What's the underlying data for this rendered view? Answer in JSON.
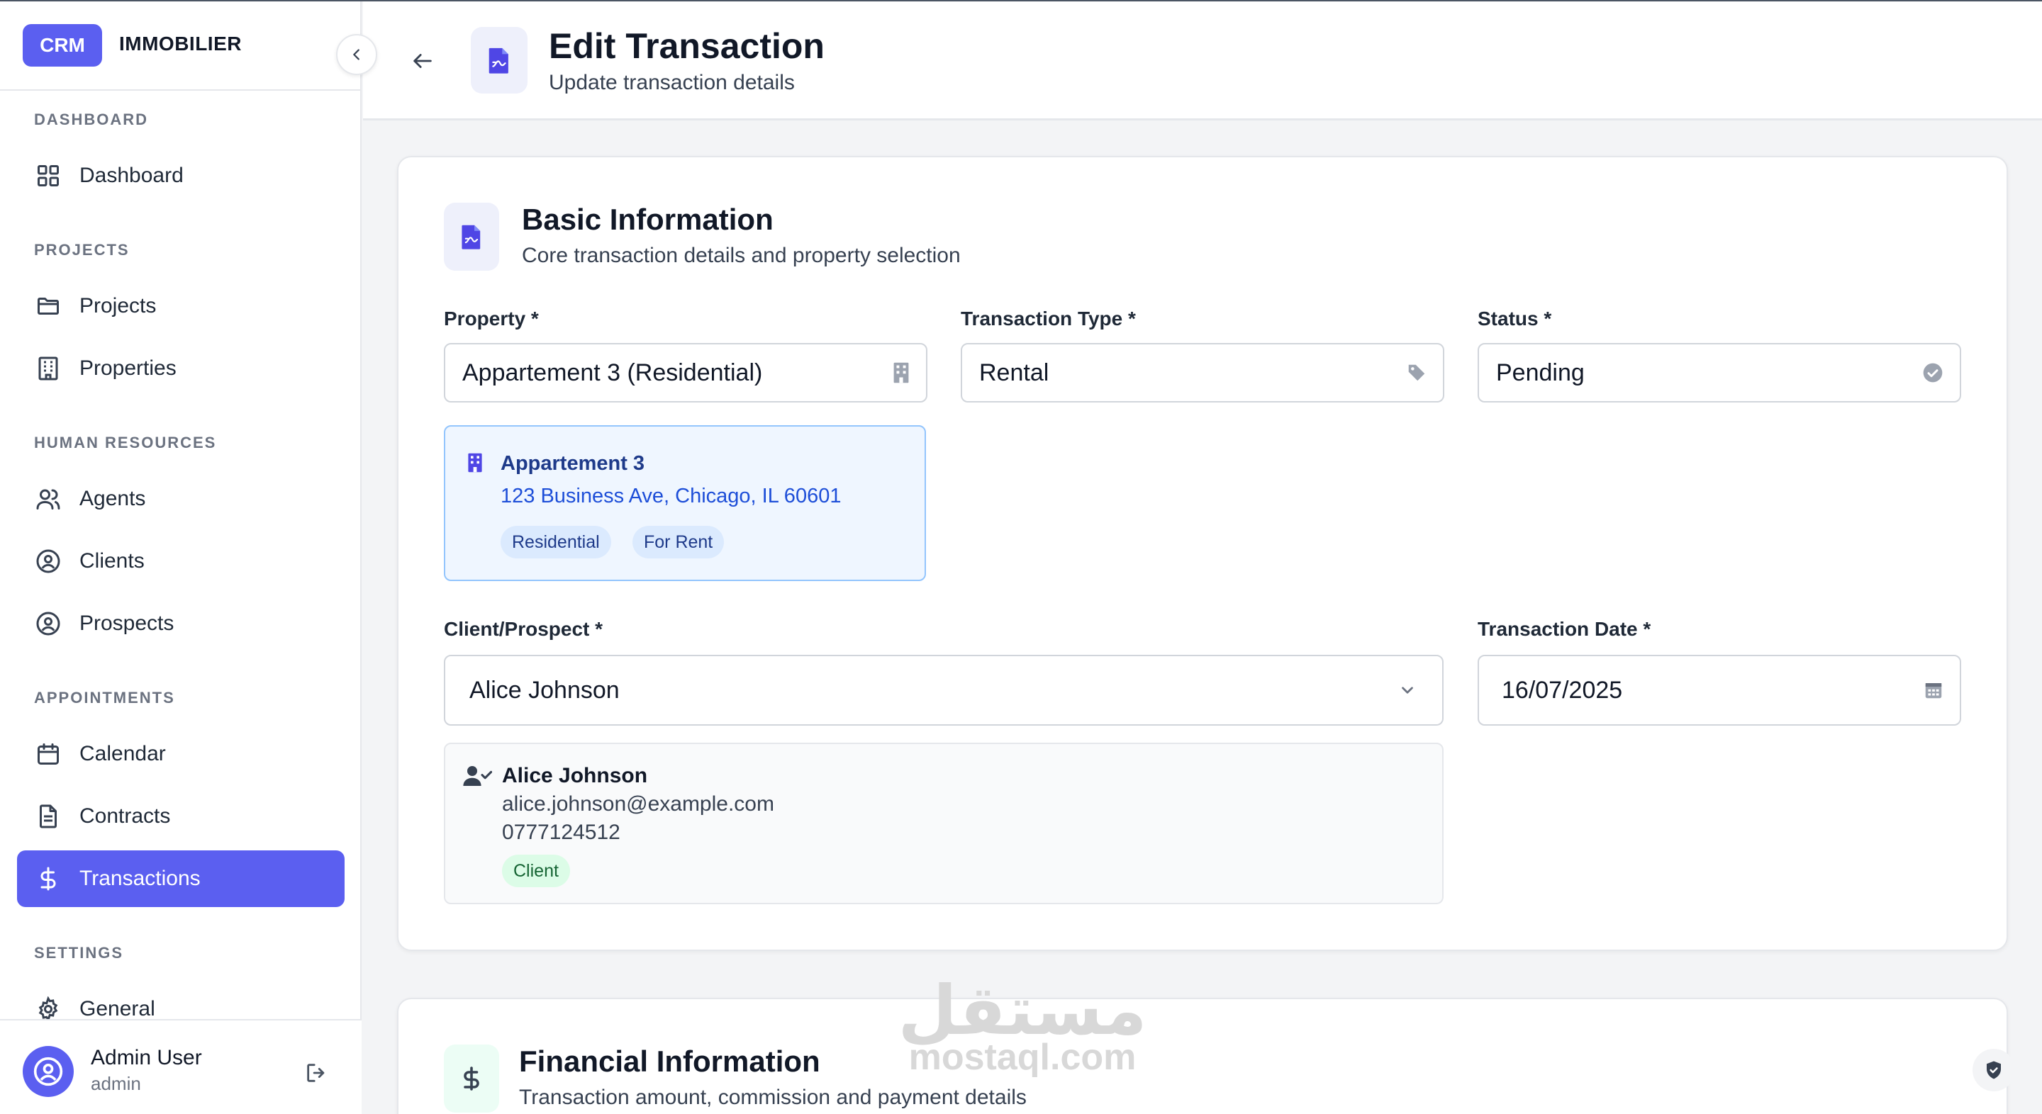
{
  "brand": {
    "badge": "CRM",
    "name": "IMMOBILIER"
  },
  "sidebar": {
    "sections": [
      {
        "title": "DASHBOARD",
        "items": [
          {
            "label": "Dashboard",
            "icon": "grid-icon"
          }
        ]
      },
      {
        "title": "PROJECTS",
        "items": [
          {
            "label": "Projects",
            "icon": "folder-icon"
          },
          {
            "label": "Properties",
            "icon": "building-icon"
          }
        ]
      },
      {
        "title": "HUMAN RESOURCES",
        "items": [
          {
            "label": "Agents",
            "icon": "users-icon"
          },
          {
            "label": "Clients",
            "icon": "user-circle-icon"
          },
          {
            "label": "Prospects",
            "icon": "user-circle-icon"
          }
        ]
      },
      {
        "title": "APPOINTMENTS",
        "items": [
          {
            "label": "Calendar",
            "icon": "calendar-icon"
          },
          {
            "label": "Contracts",
            "icon": "document-icon"
          },
          {
            "label": "Transactions",
            "icon": "dollar-icon",
            "active": true
          }
        ]
      },
      {
        "title": "SETTINGS",
        "items": [
          {
            "label": "General",
            "icon": "gear-icon"
          }
        ]
      }
    ]
  },
  "user": {
    "name": "Admin User",
    "role": "admin"
  },
  "header": {
    "title": "Edit Transaction",
    "subtitle": "Update transaction details"
  },
  "basic": {
    "title": "Basic Information",
    "subtitle": "Core transaction details and property selection",
    "property_label": "Property *",
    "property_value": "Appartement 3 (Residential)",
    "type_label": "Transaction Type *",
    "type_value": "Rental",
    "status_label": "Status *",
    "status_value": "Pending",
    "property_info": {
      "name": "Appartement 3",
      "address": "123 Business Ave, Chicago, IL 60601",
      "tags": [
        "Residential",
        "For Rent"
      ]
    },
    "client_label": "Client/Prospect *",
    "client_value": "Alice Johnson",
    "date_label": "Transaction Date *",
    "date_value": "16/07/2025",
    "client_info": {
      "name": "Alice Johnson",
      "email": "alice.johnson@example.com",
      "phone": "0777124512",
      "tag": "Client"
    }
  },
  "financial": {
    "title": "Financial Information",
    "subtitle": "Transaction amount, commission and payment details"
  },
  "watermark": {
    "arabic": "مستقل",
    "latin": "mostaql.com"
  },
  "colors": {
    "accent": "#5b5ff0",
    "info_bg": "#eff6ff",
    "info_border": "#93c5fd"
  }
}
